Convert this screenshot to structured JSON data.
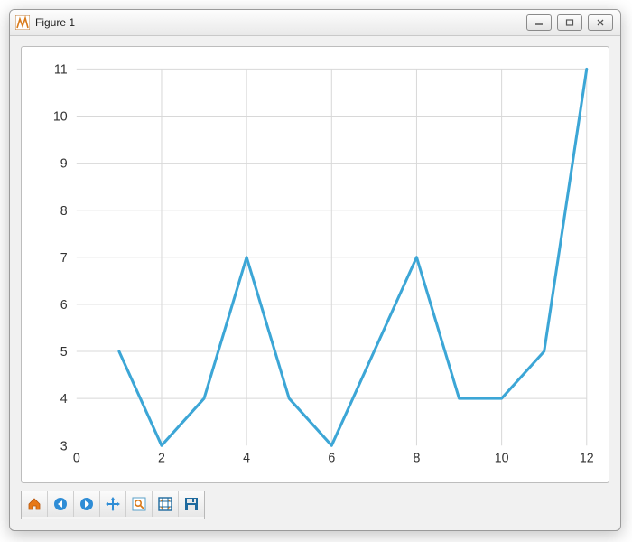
{
  "window": {
    "title": "Figure 1"
  },
  "toolbar": {
    "items": [
      {
        "name": "home-icon",
        "label": "Home"
      },
      {
        "name": "back-icon",
        "label": "Back"
      },
      {
        "name": "forward-icon",
        "label": "Forward"
      },
      {
        "name": "pan-icon",
        "label": "Pan"
      },
      {
        "name": "zoom-icon",
        "label": "Zoom"
      },
      {
        "name": "subplots-icon",
        "label": "Configure subplots"
      },
      {
        "name": "save-icon",
        "label": "Save"
      }
    ]
  },
  "colors": {
    "line": "#3ca6d6"
  },
  "chart_data": {
    "type": "line",
    "x": [
      1,
      2,
      3,
      4,
      5,
      6,
      7,
      8,
      9,
      10,
      11,
      12
    ],
    "y": [
      5,
      3,
      4,
      7,
      4,
      3,
      5,
      7,
      4,
      4,
      5,
      11
    ],
    "xticks": [
      0,
      2,
      4,
      6,
      8,
      10,
      12
    ],
    "yticks": [
      3,
      4,
      5,
      6,
      7,
      8,
      9,
      10,
      11
    ],
    "xlim": [
      0,
      12
    ],
    "ylim": [
      3,
      11
    ],
    "title": "",
    "xlabel": "",
    "ylabel": "",
    "grid": true
  }
}
